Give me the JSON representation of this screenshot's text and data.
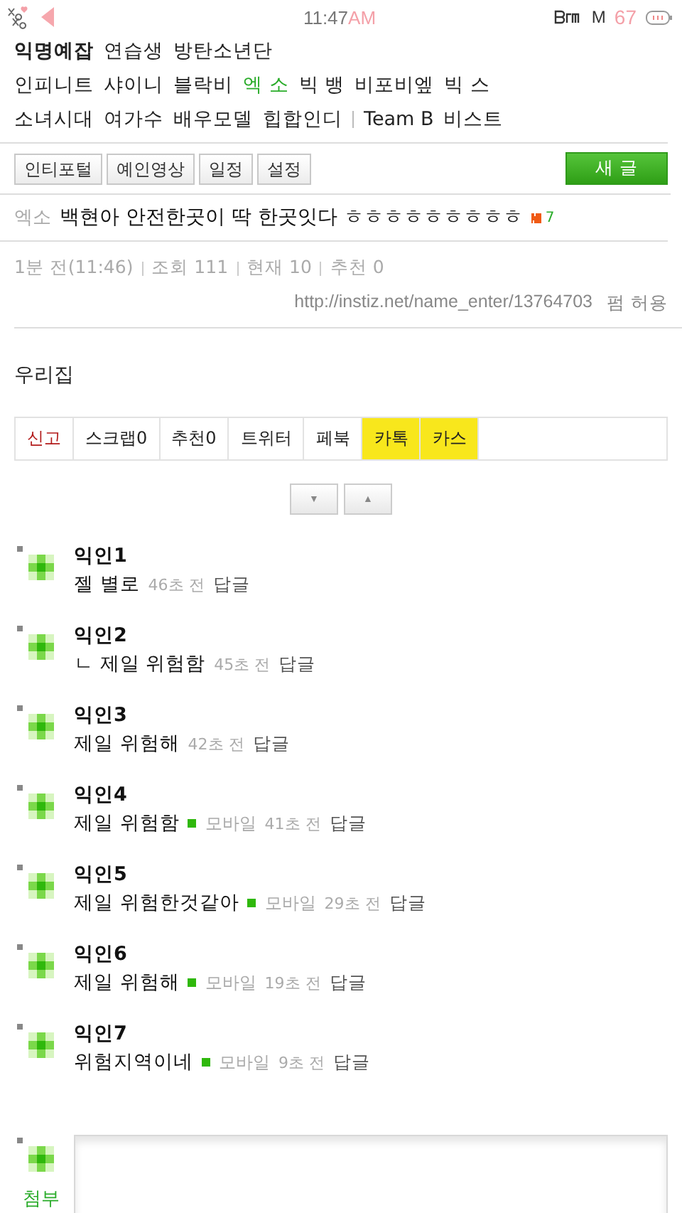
{
  "status_bar": {
    "time": "11:47",
    "ampm": "AM",
    "network": "M",
    "battery_percent": "67"
  },
  "category_rows": [
    [
      {
        "label": "익명예잡",
        "kind": "board",
        "selected": false,
        "divider_before": false
      },
      {
        "label": "연습생",
        "kind": "link",
        "selected": false,
        "divider_before": false
      },
      {
        "label": "방탄소년단",
        "kind": "link",
        "selected": false,
        "divider_before": false
      }
    ],
    [
      {
        "label": "인피니트",
        "kind": "link",
        "selected": false,
        "divider_before": false
      },
      {
        "label": "샤이니",
        "kind": "link",
        "selected": false,
        "divider_before": false
      },
      {
        "label": "블락비",
        "kind": "link",
        "selected": false,
        "divider_before": false
      },
      {
        "label": "엑 소",
        "kind": "link",
        "selected": true,
        "divider_before": false
      },
      {
        "label": "빅 뱅",
        "kind": "link",
        "selected": false,
        "divider_before": false
      },
      {
        "label": "비포비엪",
        "kind": "link",
        "selected": false,
        "divider_before": false
      },
      {
        "label": "빅 스",
        "kind": "link",
        "selected": false,
        "divider_before": false
      }
    ],
    [
      {
        "label": "소녀시대",
        "kind": "link",
        "selected": false,
        "divider_before": false
      },
      {
        "label": "여가수",
        "kind": "link",
        "selected": false,
        "divider_before": false
      },
      {
        "label": "배우모델",
        "kind": "link",
        "selected": false,
        "divider_before": false
      },
      {
        "label": "힙합인디",
        "kind": "link",
        "selected": false,
        "divider_before": false
      },
      {
        "label": "Team B",
        "kind": "link",
        "selected": false,
        "divider_before": true
      },
      {
        "label": "비스트",
        "kind": "link",
        "selected": false,
        "divider_before": false
      }
    ]
  ],
  "toolbar": {
    "buttons": [
      "인티포털",
      "예인영상",
      "일정",
      "설정"
    ],
    "new_post": "새 글"
  },
  "post": {
    "category": "엑소",
    "title": "백현아 안전한곳이 딱 한곳잇다 ㅎㅎㅎㅎㅎㅎㅎㅎㅎ",
    "is_new": true,
    "comment_count": "7",
    "meta": [
      "1분 전(11:46)",
      "조회 111",
      "현재 10",
      "추천 0"
    ],
    "url": "http://instiz.net/name_enter/13764703",
    "permission": "펌 허용",
    "body": "우리집"
  },
  "share_bar": [
    {
      "label": "신고",
      "kind": "report"
    },
    {
      "label": "스크랩0",
      "kind": "plain"
    },
    {
      "label": "추천0",
      "kind": "plain"
    },
    {
      "label": "트위터",
      "kind": "plain"
    },
    {
      "label": "페북",
      "kind": "plain"
    },
    {
      "label": "카톡",
      "kind": "kakao"
    },
    {
      "label": "카스",
      "kind": "kakao"
    }
  ],
  "nav_buttons": [
    "▼",
    "▲"
  ],
  "comments": [
    {
      "name": "익인1",
      "text": "젤 별로",
      "mobile": false,
      "time": "46초 전",
      "reply": "답글"
    },
    {
      "name": "익인2",
      "text": "ㄴ 제일 위험함",
      "mobile": false,
      "time": "45초 전",
      "reply": "답글"
    },
    {
      "name": "익인3",
      "text": "제일 위험해",
      "mobile": false,
      "time": "42초 전",
      "reply": "답글"
    },
    {
      "name": "익인4",
      "text": "제일 위험함",
      "mobile": true,
      "mobile_label": "모바일",
      "time": "41초 전",
      "reply": "답글"
    },
    {
      "name": "익인5",
      "text": "제일 위험한것같아",
      "mobile": true,
      "mobile_label": "모바일",
      "time": "29초 전",
      "reply": "답글"
    },
    {
      "name": "익인6",
      "text": "제일 위험해",
      "mobile": true,
      "mobile_label": "모바일",
      "time": "19초 전",
      "reply": "답글"
    },
    {
      "name": "익인7",
      "text": "위험지역이네",
      "mobile": true,
      "mobile_label": "모바일",
      "time": "9초 전",
      "reply": "답글"
    }
  ],
  "composer": {
    "attach": "첨부"
  }
}
